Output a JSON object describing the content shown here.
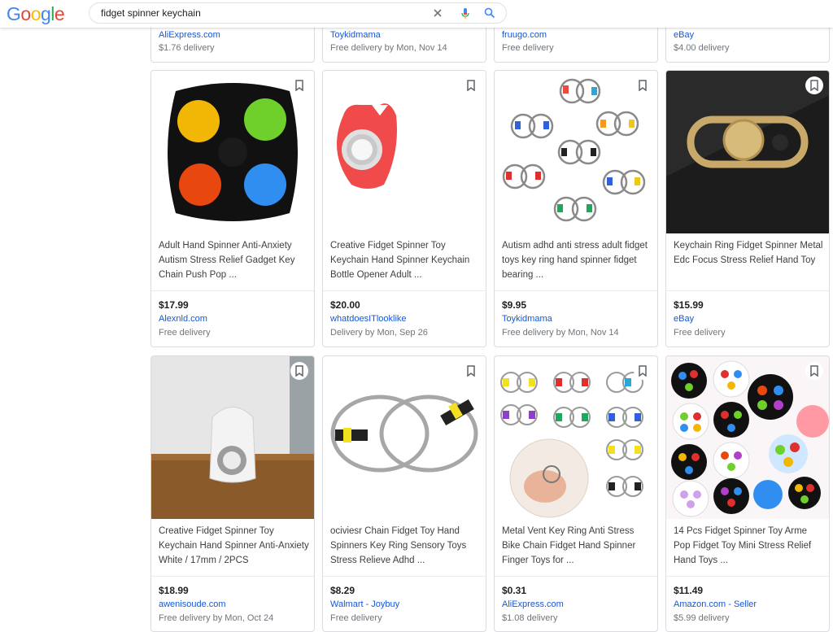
{
  "header": {
    "logo_letters": [
      "G",
      "o",
      "o",
      "g",
      "l",
      "e"
    ],
    "search_value": "fidget spinner keychain"
  },
  "top_row": [
    {
      "store": "AliExpress.com",
      "delivery": "$1.76 delivery"
    },
    {
      "store": "Toykidmama",
      "delivery": "Free delivery by Mon, Nov 14"
    },
    {
      "store": "fruugo.com",
      "delivery": "Free delivery"
    },
    {
      "store": "eBay",
      "delivery": "$4.00 delivery"
    }
  ],
  "products": [
    {
      "title": "Adult Hand Spinner Anti-Anxiety Autism Stress Relief Gadget Key Chain Push Pop ...",
      "price": "$17.99",
      "store": "Alexnld.com",
      "delivery": "Free delivery"
    },
    {
      "title": "Creative Fidget Spinner Toy Keychain Hand Spinner Keychain Bottle Opener Adult ...",
      "price": "$20.00",
      "store": "whatdoesITlooklike",
      "delivery": "Delivery by Mon, Sep 26"
    },
    {
      "title": "Autism adhd anti stress adult fidget toys key ring hand spinner fidget bearing ...",
      "price": "$9.95",
      "store": "Toykidmama",
      "delivery": "Free delivery by Mon, Nov 14"
    },
    {
      "title": "Keychain Ring Fidget Spinner Metal Edc Focus Stress Relief Hand Toy",
      "price": "$15.99",
      "store": "eBay",
      "delivery": "Free delivery"
    },
    {
      "title": "Creative Fidget Spinner Toy Keychain Hand Spinner Anti-Anxiety White / 17mm / 2PCS",
      "price": "$18.99",
      "store": "awenisoude.com",
      "delivery": "Free delivery by Mon, Oct 24"
    },
    {
      "title": "ociviesr Chain Fidget Toy Hand Spinners Key Ring Sensory Toys Stress Relieve Adhd ...",
      "price": "$8.29",
      "store": "Walmart - Joybuy",
      "delivery": "Free delivery"
    },
    {
      "title": "Metal Vent Key Ring Anti Stress Bike Chain Fidget Hand Spinner Finger Toys for ...",
      "price": "$0.31",
      "store": "AliExpress.com",
      "delivery": "$1.08 delivery"
    },
    {
      "title": "14 Pcs Fidget Spinner Toy Arme Pop Fidget Toy Mini Stress Relief Hand Toys ...",
      "price": "$11.49",
      "store": "Amazon.com - Seller",
      "delivery": "$5.99 delivery"
    }
  ],
  "colors": {
    "link": "#1558d6",
    "muted": "#70757a",
    "border": "#dadce0"
  }
}
